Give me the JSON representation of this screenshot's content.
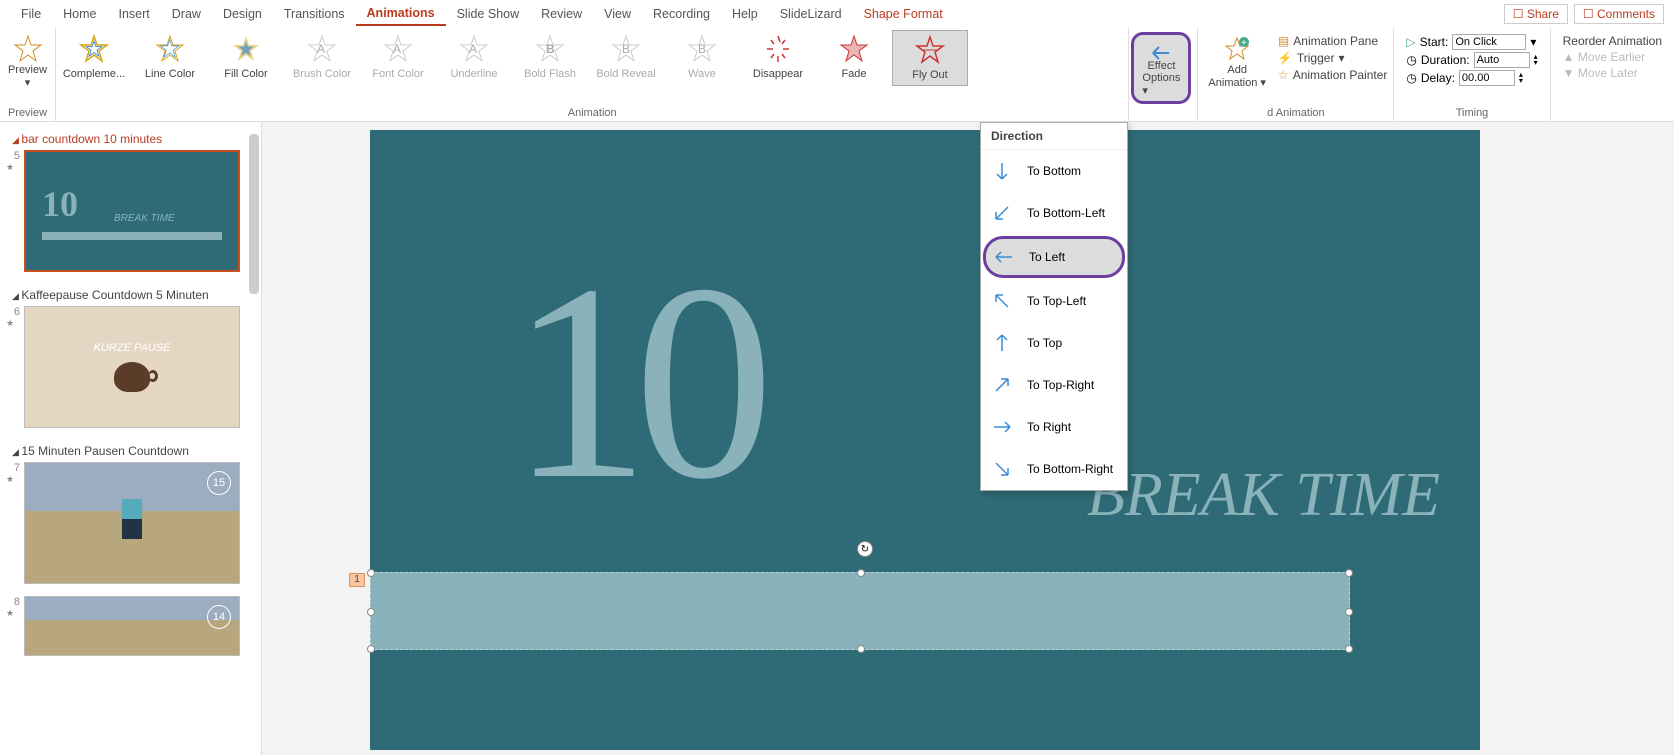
{
  "menu": {
    "tabs": [
      "File",
      "Home",
      "Insert",
      "Draw",
      "Design",
      "Transitions",
      "Animations",
      "Slide Show",
      "Review",
      "View",
      "Recording",
      "Help",
      "SlideLizard",
      "Shape Format"
    ],
    "share": "Share",
    "comments": "Comments"
  },
  "ribbon": {
    "preview": "Preview",
    "animations": [
      "Compleme...",
      "Line Color",
      "Fill Color",
      "Brush Color",
      "Font Color",
      "Underline",
      "Bold Flash",
      "Bold Reveal",
      "Wave",
      "Disappear",
      "Fade",
      "Fly Out"
    ],
    "effect_line1": "Effect",
    "effect_line2": "Options",
    "add_line1": "Add",
    "add_line2": "Animation",
    "pane": "Animation Pane",
    "trigger": "Trigger",
    "painter": "Animation Painter",
    "start_label": "Start:",
    "start_val": "On Click",
    "duration_label": "Duration:",
    "duration_val": "Auto",
    "delay_label": "Delay:",
    "delay_val": "00.00",
    "reorder": "Reorder Animation",
    "earlier": "Move Earlier",
    "later": "Move Later",
    "group_preview": "Preview",
    "group_animation": "Animation",
    "group_advanced": "d Animation",
    "group_timing": "Timing"
  },
  "dropdown": {
    "header": "Direction",
    "opts": [
      "To Bottom",
      "To Bottom-Left",
      "To Left",
      "To Top-Left",
      "To Top",
      "To Top-Right",
      "To Right",
      "To Bottom-Right"
    ]
  },
  "sidebar": {
    "sec1": "bar countdown 10 minutes",
    "sec2": "Kaffeepause Countdown 5 Minuten",
    "sec3": "15 Minuten Pausen Countdown",
    "s5": "5",
    "s6": "6",
    "s7": "7",
    "s8": "8",
    "t10": "10",
    "tbreak": "BREAK TIME",
    "tpause": "KURZE PAUSE",
    "b15": "15",
    "b14": "14"
  },
  "slide": {
    "ten": "10",
    "break": "BREAK TIME",
    "tag": "1"
  }
}
